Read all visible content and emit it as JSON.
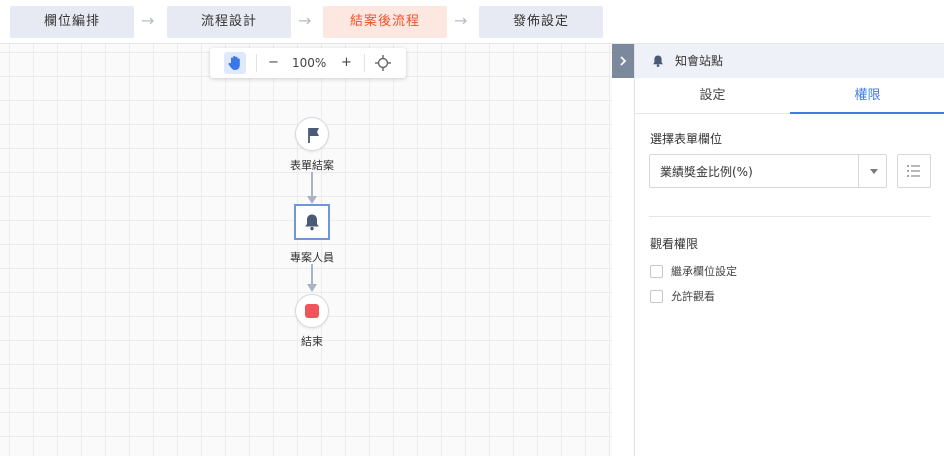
{
  "steps": [
    {
      "label": "欄位編排"
    },
    {
      "label": "流程設計"
    },
    {
      "label": "結案後流程"
    },
    {
      "label": "發佈設定"
    }
  ],
  "step_arrow": "→",
  "active_step": 2,
  "toolbar": {
    "hand_icon": "hand-icon",
    "zoom_out": "−",
    "zoom_level": "100%",
    "zoom_in": "+",
    "center_icon": "crosshair-icon"
  },
  "flow": {
    "start_label": "表單結案",
    "notify_label": "專案人員",
    "end_label": "結束"
  },
  "panel": {
    "collapse_icon": "chevron-right-icon",
    "title": "知會站點",
    "title_icon": "bell-icon",
    "tabs": [
      {
        "label": "設定"
      },
      {
        "label": "權限"
      }
    ],
    "active_tab": 1,
    "select_field_label": "選擇表單欄位",
    "select_value": "業績獎金比例(%)",
    "view_permission_label": "觀看權限",
    "checkboxes": [
      {
        "label": "繼承欄位設定",
        "checked": false
      },
      {
        "label": "允許觀看",
        "checked": false
      }
    ]
  },
  "colors": {
    "accent": "#3f7de0",
    "active_step_bg": "#fde7e1",
    "active_step_text": "#f0512a",
    "end_node": "#f2545b",
    "flow_node_border": "#6f97dc"
  }
}
